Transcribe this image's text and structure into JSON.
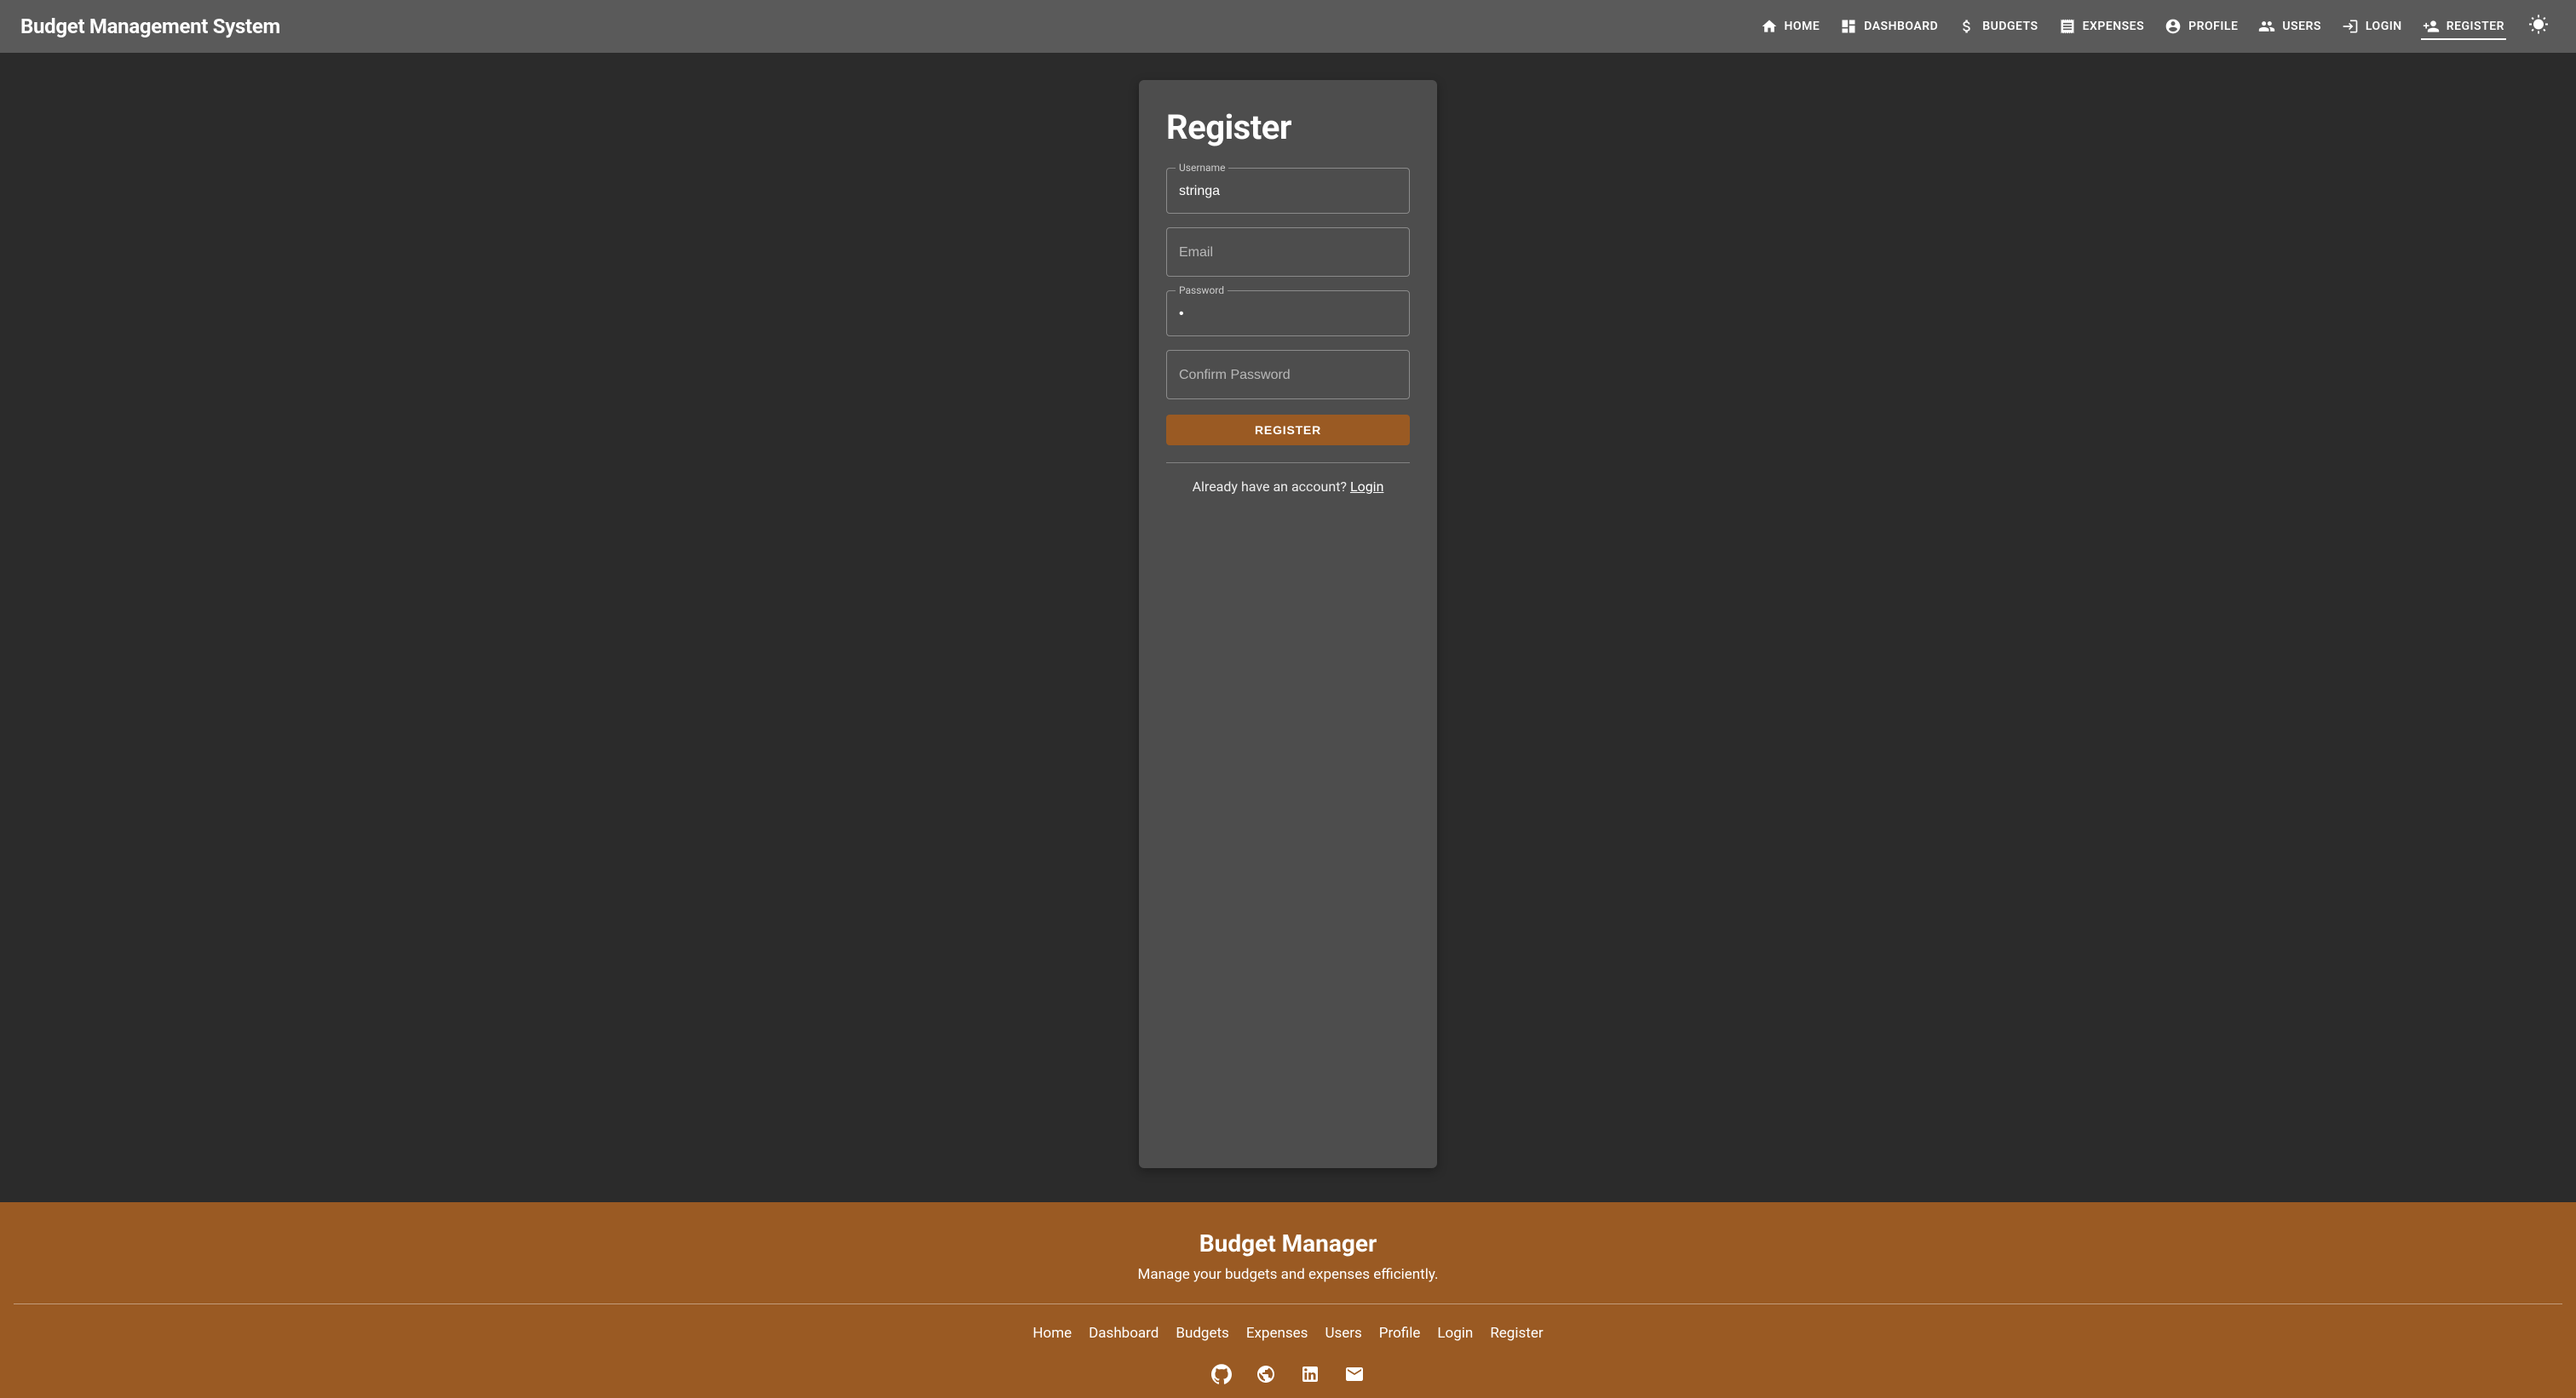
{
  "header": {
    "brand": "Budget Management System",
    "nav": [
      {
        "icon": "home",
        "label": "HOME"
      },
      {
        "icon": "dashboard",
        "label": "DASHBOARD"
      },
      {
        "icon": "dollar",
        "label": "BUDGETS"
      },
      {
        "icon": "receipt",
        "label": "EXPENSES"
      },
      {
        "icon": "account",
        "label": "PROFILE"
      },
      {
        "icon": "users",
        "label": "USERS"
      },
      {
        "icon": "login",
        "label": "LOGIN"
      },
      {
        "icon": "person-add",
        "label": "REGISTER",
        "active": true
      }
    ]
  },
  "form": {
    "title": "Register",
    "username": {
      "label": "Username",
      "value": "stringa"
    },
    "email": {
      "placeholder": "Email",
      "value": ""
    },
    "password": {
      "label": "Password",
      "value": "•"
    },
    "confirm": {
      "placeholder": "Confirm Password",
      "value": ""
    },
    "submit": "REGISTER",
    "prompt_text": "Already have an account? ",
    "prompt_link": "Login"
  },
  "footer": {
    "title": "Budget Manager",
    "subtitle": "Manage your budgets and expenses efficiently.",
    "links": [
      "Home",
      "Dashboard",
      "Budgets",
      "Expenses",
      "Users",
      "Profile",
      "Login",
      "Register"
    ],
    "social": [
      "github",
      "globe",
      "linkedin",
      "mail"
    ]
  }
}
